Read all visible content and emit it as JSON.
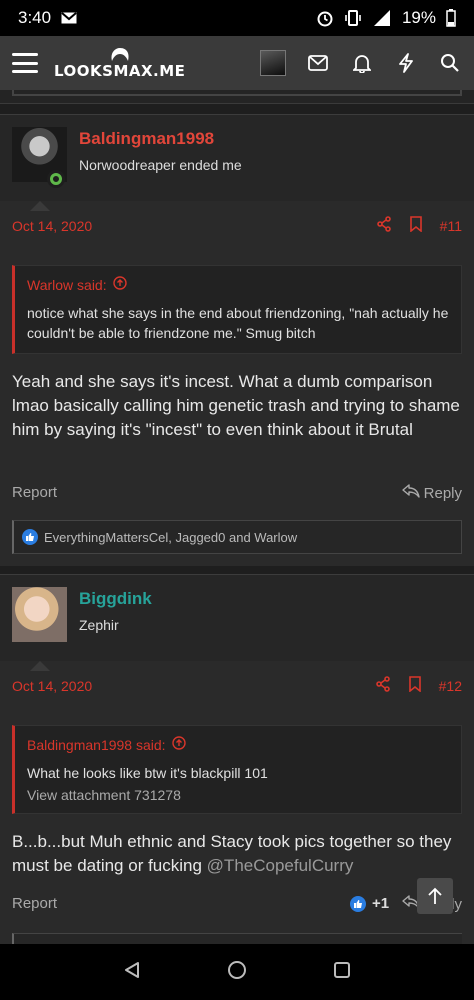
{
  "status_bar": {
    "time": "3:40",
    "battery": "19%"
  },
  "header": {
    "logo": "LOOKSMAX.ME"
  },
  "posts": [
    {
      "username": "Baldingman1998",
      "user_title": "Norwoodreaper ended me",
      "date": "Oct 14, 2020",
      "number": "#11",
      "quote": {
        "author": "Warlow said:",
        "text": "notice what she says in the end about friendzoning, \"nah actually he couldn't be able to friendzone me.\" Smug bitch"
      },
      "body": "Yeah and she says it's incest. What a dumb comparison lmao basically calling him genetic trash and trying to shame him by saying it's \"incest\" to even think about it Brutal",
      "report": "Report",
      "reply": "Reply",
      "reactions": "EverythingMattersCel, Jagged0 and Warlow"
    },
    {
      "username": "Biggdink",
      "user_title": "Zephir",
      "date": "Oct 14, 2020",
      "number": "#12",
      "quote": {
        "author": "Baldingman1998 said:",
        "text": "What he looks like btw it's blackpill 101",
        "link": "View attachment 731278"
      },
      "body": "B...b...but Muh ethnic and Stacy took pics together so they must be dating or fucking ",
      "mention": "@TheCopefulCurry",
      "report": "Report",
      "reply": "Reply",
      "reaction_count": "+1"
    }
  ],
  "colors": {
    "accent_red": "#d9362b",
    "username_red": "#e2463a",
    "username_teal": "#27a39a"
  }
}
